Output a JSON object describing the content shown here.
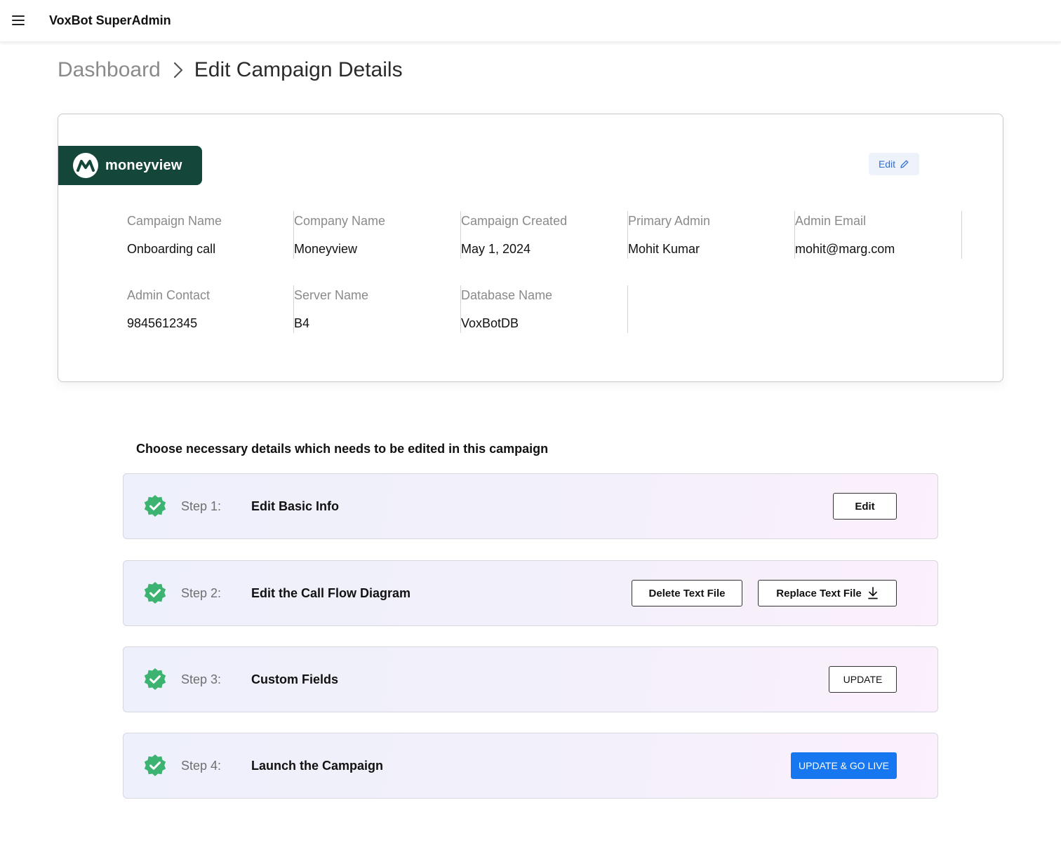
{
  "header": {
    "app_title": "VoxBot SuperAdmin",
    "menu_icon": "hamburger-menu-icon"
  },
  "breadcrumb": {
    "parent": "Dashboard",
    "current": "Edit Campaign Details",
    "separator_icon": "chevron-right-icon"
  },
  "campaign_card": {
    "logo_text": "moneyview",
    "logo_color": "#15463a",
    "edit_label": "Edit",
    "edit_icon": "pencil-icon",
    "fields": [
      {
        "label": "Campaign Name",
        "value": "Onboarding call"
      },
      {
        "label": "Company Name",
        "value": "Moneyview"
      },
      {
        "label": "Campaign Created",
        "value": "May 1, 2024"
      },
      {
        "label": "Primary Admin",
        "value": "Mohit Kumar"
      },
      {
        "label": "Admin Email",
        "value": "mohit@marg.com"
      },
      {
        "label": "Admin Contact",
        "value": "9845612345"
      },
      {
        "label": "Server Name",
        "value": "B4"
      },
      {
        "label": "Database Name",
        "value": "VoxBotDB"
      }
    ]
  },
  "steps_section": {
    "title": "Choose necessary details which needs to be edited in this campaign",
    "check_color": "#3cb371",
    "primary_color": "#1677f0",
    "steps": [
      {
        "number": "Step 1:",
        "title": "Edit Basic Info",
        "actions": [
          "Edit"
        ]
      },
      {
        "number": "Step 2:",
        "title": "Edit the Call Flow Diagram",
        "actions": [
          "Delete Text File",
          "Replace Text File"
        ]
      },
      {
        "number": "Step 3:",
        "title": "Custom Fields",
        "actions": [
          "UPDATE"
        ]
      },
      {
        "number": "Step 4:",
        "title": "Launch the Campaign",
        "actions": [
          "UPDATE & GO LIVE"
        ]
      }
    ]
  }
}
